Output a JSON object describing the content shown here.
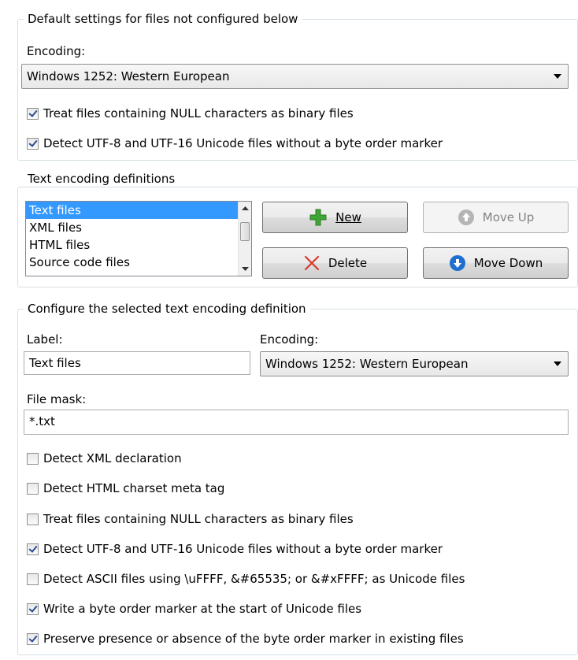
{
  "default_group": {
    "title": "Default settings for files not configured below",
    "encoding_label": "Encoding:",
    "encoding_value": "Windows 1252: Western European",
    "checks": [
      {
        "label": "Treat files containing NULL characters as binary files",
        "checked": true
      },
      {
        "label": "Detect UTF-8 and UTF-16 Unicode files without a byte order marker",
        "checked": true
      }
    ]
  },
  "definitions_group": {
    "title": "Text encoding definitions",
    "items": [
      "Text files",
      "XML files",
      "HTML files",
      "Source code files"
    ],
    "selected_index": 0,
    "buttons": {
      "new": "New",
      "delete": "Delete",
      "move_up": "Move Up",
      "move_down": "Move Down"
    }
  },
  "configure_group": {
    "title": "Configure the selected text encoding definition",
    "label_label": "Label:",
    "label_value": "Text files",
    "encoding_label": "Encoding:",
    "encoding_value": "Windows 1252: Western European",
    "file_mask_label": "File mask:",
    "file_mask_value": "*.txt",
    "checks": [
      {
        "label": "Detect XML declaration",
        "checked": false
      },
      {
        "label": "Detect HTML charset meta tag",
        "checked": false
      },
      {
        "label": "Treat files containing NULL characters as binary files",
        "checked": false
      },
      {
        "label": "Detect UTF-8 and UTF-16 Unicode files without a byte order marker",
        "checked": true
      },
      {
        "label": "Detect ASCII files using \\uFFFF, &#65535; or &#xFFFF; as Unicode files",
        "checked": false
      },
      {
        "label": "Write a byte order marker at the start of Unicode files",
        "checked": true
      },
      {
        "label": "Preserve presence or absence of the byte order marker in existing files",
        "checked": true
      }
    ]
  },
  "colors": {
    "selection": "#3399ff",
    "group_border": "#d5dfe5",
    "new_icon": "#3fa535",
    "delete_icon": "#d83a2a",
    "move_down_icon": "#1f6fd0"
  }
}
